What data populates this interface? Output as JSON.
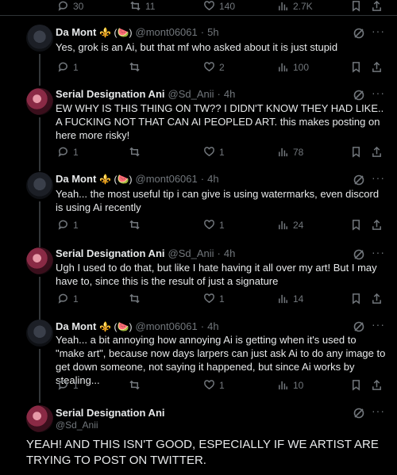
{
  "top_actions": {
    "replies": "30",
    "reposts": "11",
    "likes": "140",
    "views": "2.7K"
  },
  "tweets": [
    {
      "name": "Da Mont",
      "emoji": "⚜️ (🍉)",
      "handle": "@mont06061",
      "time": "5h",
      "text": "Yes, grok is an Ai, but that mf who asked about it is just stupid",
      "replies": "1",
      "reposts": "",
      "likes": "2",
      "views": "100"
    },
    {
      "name": "Serial Designation Ani",
      "emoji": "",
      "handle": "@Sd_Anii",
      "time": "4h",
      "text": "EW WHY IS THIS THING ON TW?? I DIDN'T KNOW THEY HAD LIKE.. A FUCKING NOT THAT CAN AI PEOPLED ART. this makes posting on here more risky!",
      "replies": "1",
      "reposts": "",
      "likes": "1",
      "views": "78"
    },
    {
      "name": "Da Mont",
      "emoji": "⚜️ (🍉)",
      "handle": "@mont06061",
      "time": "4h",
      "text": "Yeah... the most useful tip i can give is using watermarks, even discord is using Ai recently",
      "replies": "1",
      "reposts": "",
      "likes": "1",
      "views": "24"
    },
    {
      "name": "Serial Designation Ani",
      "emoji": "",
      "handle": "@Sd_Anii",
      "time": "4h",
      "text": "Ugh I used to do that, but like I hate having it all over my art! But I may have to, since this is the result of just a signature",
      "replies": "1",
      "reposts": "",
      "likes": "1",
      "views": "14"
    },
    {
      "name": "Da Mont",
      "emoji": "⚜️ (🍉)",
      "handle": "@mont06061",
      "time": "4h",
      "text": "Yeah... a bit annoying how annoying Ai is getting when it's used to \"make art\", because now days larpers can just ask Ai to do any image to get down someone, not saying it happened, but since Ai works by stealing...",
      "replies": "1",
      "reposts": "",
      "likes": "1",
      "views": "10"
    }
  ],
  "main_tweet": {
    "name": "Serial Designation Ani",
    "handle": "@Sd_Anii",
    "text": "YEAH! AND THIS ISN'T GOOD, ESPECIALLY IF WE ARTIST ARE TRYING TO POST ON TWITTER."
  }
}
